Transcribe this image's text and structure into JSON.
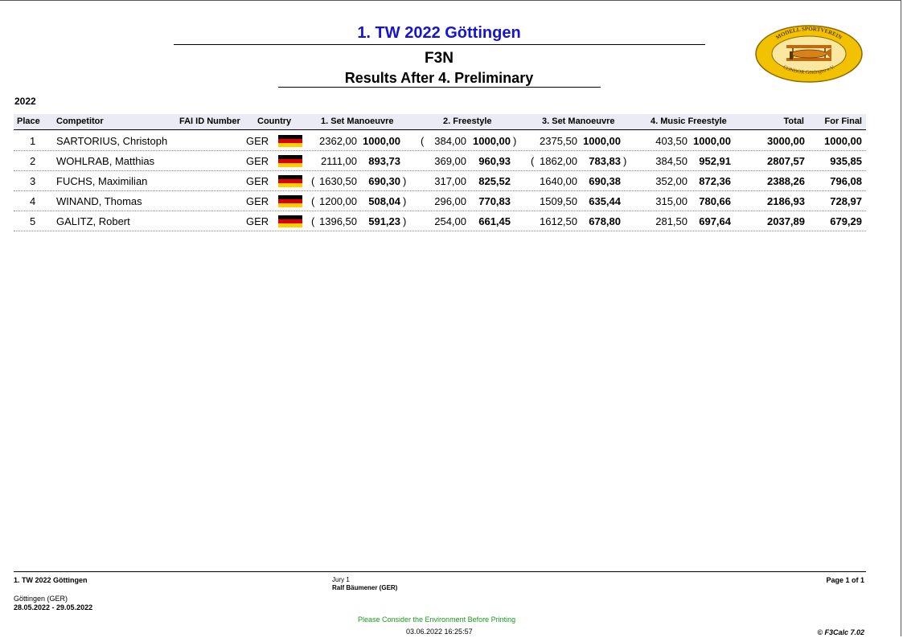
{
  "header": {
    "event_title": "1. TW 2022 Göttingen",
    "class_name": "F3N",
    "subtitle": "Results After 4. Preliminary",
    "year": "2022",
    "logo_text_top": "MODELL SPORTVEREIN",
    "logo_text_bottom": "CONDOR Göttingen e.V."
  },
  "columns": {
    "place": "Place",
    "competitor": "Competitor",
    "fai_id": "FAI ID Number",
    "country": "Country",
    "r1": "1. Set Manoeuvre",
    "r2": "2. Freestyle",
    "r3": "3. Set Manoeuvre",
    "r4": "4. Music Freestyle",
    "total": "Total",
    "final": "For Final"
  },
  "rows": [
    {
      "place": "1",
      "name": "SARTORIUS, Christoph",
      "country": "GER",
      "r1_raw": "2362,00",
      "r1_norm": "1000,00",
      "r1_dropped": false,
      "r2_raw": "384,00",
      "r2_norm": "1000,00",
      "r2_dropped": true,
      "r3_raw": "2375,50",
      "r3_norm": "1000,00",
      "r3_dropped": false,
      "r4_raw": "403,50",
      "r4_norm": "1000,00",
      "total": "3000,00",
      "final": "1000,00"
    },
    {
      "place": "2",
      "name": "WOHLRAB, Matthias",
      "country": "GER",
      "r1_raw": "2111,00",
      "r1_norm": "893,73",
      "r1_dropped": false,
      "r2_raw": "369,00",
      "r2_norm": "960,93",
      "r2_dropped": false,
      "r3_raw": "1862,00",
      "r3_norm": "783,83",
      "r3_dropped": true,
      "r4_raw": "384,50",
      "r4_norm": "952,91",
      "total": "2807,57",
      "final": "935,85"
    },
    {
      "place": "3",
      "name": "FUCHS, Maximilian",
      "country": "GER",
      "r1_raw": "1630,50",
      "r1_norm": "690,30",
      "r1_dropped": true,
      "r2_raw": "317,00",
      "r2_norm": "825,52",
      "r2_dropped": false,
      "r3_raw": "1640,00",
      "r3_norm": "690,38",
      "r3_dropped": false,
      "r4_raw": "352,00",
      "r4_norm": "872,36",
      "total": "2388,26",
      "final": "796,08"
    },
    {
      "place": "4",
      "name": "WINAND, Thomas",
      "country": "GER",
      "r1_raw": "1200,00",
      "r1_norm": "508,04",
      "r1_dropped": true,
      "r2_raw": "296,00",
      "r2_norm": "770,83",
      "r2_dropped": false,
      "r3_raw": "1509,50",
      "r3_norm": "635,44",
      "r3_dropped": false,
      "r4_raw": "315,00",
      "r4_norm": "780,66",
      "total": "2186,93",
      "final": "728,97"
    },
    {
      "place": "5",
      "name": "GALITZ, Robert",
      "country": "GER",
      "r1_raw": "1396,50",
      "r1_norm": "591,23",
      "r1_dropped": true,
      "r2_raw": "254,00",
      "r2_norm": "661,45",
      "r2_dropped": false,
      "r3_raw": "1612,50",
      "r3_norm": "678,80",
      "r3_dropped": false,
      "r4_raw": "281,50",
      "r4_norm": "697,64",
      "total": "2037,89",
      "final": "679,29"
    }
  ],
  "footer": {
    "event": "1. TW 2022 Göttingen",
    "location": "Göttingen (GER)",
    "dates": "28.05.2022 - 29.05.2022",
    "jury_label": "Jury 1",
    "jury_name": "Ralf Bäumener (GER)",
    "page": "Page 1 of 1",
    "environment_note": "Please Consider the Environment Before Printing",
    "printed": "03.06.2022 16:25:57",
    "software": "© F3Calc 7.02"
  },
  "colors": {
    "title": "#1414d2",
    "header_band": "#ebebf5",
    "environment_note": "#1a9a1a",
    "flag": [
      "#000000",
      "#dd0000",
      "#ffce00"
    ]
  }
}
